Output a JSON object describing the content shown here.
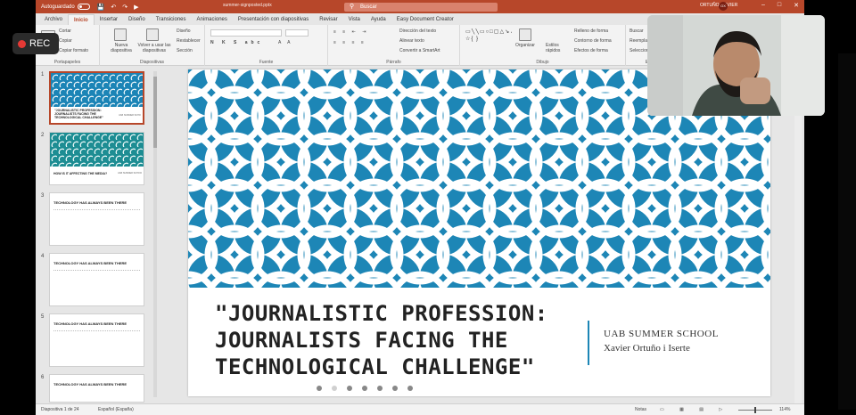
{
  "titlebar": {
    "autosave_label": "Autoguardado",
    "doc_title": "summer-signposted.pptx",
    "search_placeholder": "Buscar",
    "user_name": "ORTUÑO, XAVIER",
    "user_initials": "OX"
  },
  "tabs": [
    "Archivo",
    "Inicio",
    "Insertar",
    "Diseño",
    "Transiciones",
    "Animaciones",
    "Presentación con diapositivas",
    "Revisar",
    "Vista",
    "Ayuda",
    "Easy Document Creator"
  ],
  "active_tab": "Inicio",
  "ribbon": {
    "clipboard": {
      "cut": "Cortar",
      "copy": "Copiar",
      "format_painter": "Copiar formato",
      "label": "Portapapeles"
    },
    "slides": {
      "new_slide": "Nueva diapositiva",
      "reuse": "Volver a usar las diapositivas",
      "layout": "Diseño",
      "reset": "Restablecer",
      "section": "Sección",
      "label": "Diapositivas"
    },
    "font": {
      "label": "Fuente"
    },
    "paragraph": {
      "text_direction": "Dirección del texto",
      "align_text": "Alinear texto",
      "smartart": "Convertir a SmartArt",
      "label": "Párrafo"
    },
    "drawing": {
      "arrange": "Organizar",
      "quick_styles": "Estilos rápidos",
      "fill": "Relleno de forma",
      "outline": "Contorno de forma",
      "effects": "Efectos de forma",
      "label": "Dibujo"
    },
    "editing": {
      "find": "Buscar",
      "replace": "Reemplazar",
      "select": "Seleccionar",
      "label": "Edición"
    }
  },
  "thumbnails": [
    {
      "number": "1",
      "title_lines": [
        "\"JOURNALISTIC PROFESSION:",
        "JOURNALISTS FACING THE",
        "TECHNOLOGICAL CHALLENGE\""
      ],
      "side_text": "UAB SUMMER SCHOOL"
    },
    {
      "number": "2",
      "title_lines": [
        "HOW IS IT AFFECTING THE MEDIA?"
      ],
      "side_text": "UAB SUMMER SCHOOL"
    },
    {
      "number": "3",
      "title_lines": [
        "TECHNOLOGY HAS ALWAYS BEEN THERE"
      ]
    },
    {
      "number": "4",
      "title_lines": [
        "TECHNOLOGY HAS ALWAYS BEEN THERE"
      ]
    },
    {
      "number": "5",
      "title_lines": [
        "TECHNOLOGY HAS ALWAYS BEEN THERE"
      ]
    },
    {
      "number": "6",
      "title_lines": [
        "TECHNOLOGY HAS ALWAYS BEEN THERE"
      ]
    }
  ],
  "slide": {
    "title_lines": [
      "\"JOURNALISTIC PROFESSION:",
      "JOURNALISTS FACING THE",
      "TECHNOLOGICAL CHALLENGE\""
    ],
    "subtitle_line1": "UAB SUMMER SCHOOL",
    "subtitle_line2": "Xavier Ortuño i Iserte"
  },
  "status": {
    "slide_counter": "Diapositiva 1 de 24",
    "language": "Español (España)",
    "notes": "Notas",
    "zoom": "114%"
  },
  "recording": {
    "label": "REC"
  },
  "colors": {
    "accent": "#b7472a",
    "slide_pattern": "#1d86b6",
    "thumb2_pattern": "#1d8d93"
  }
}
